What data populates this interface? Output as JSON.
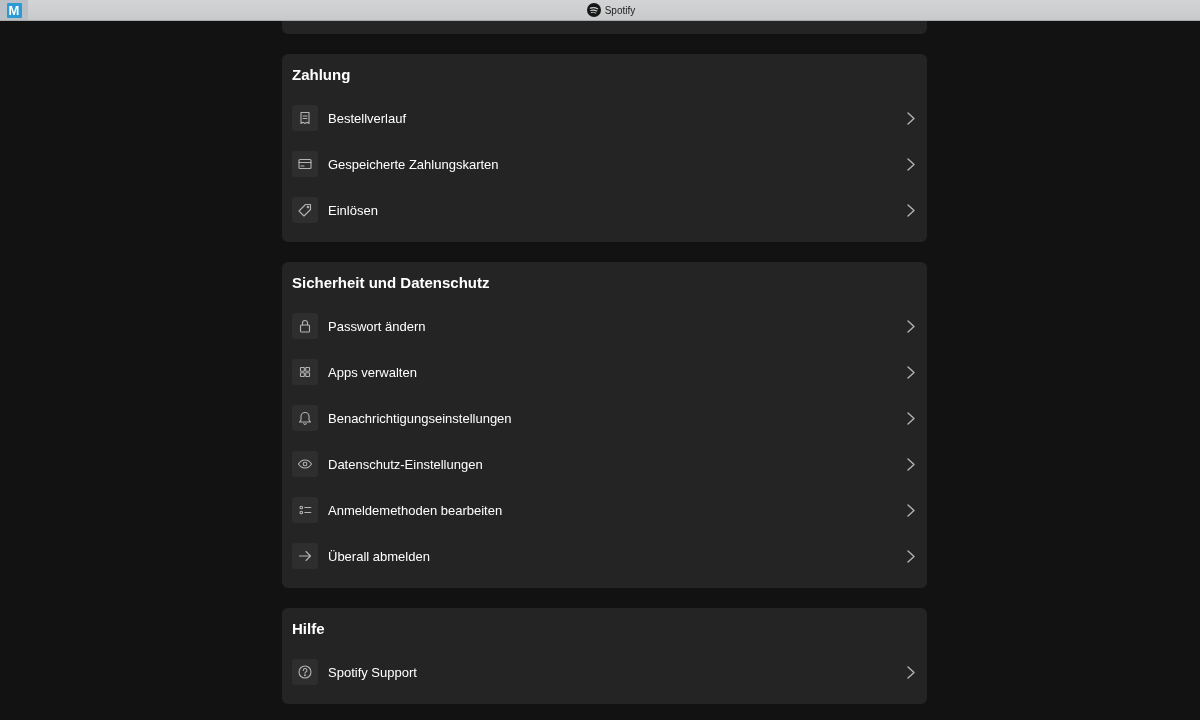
{
  "title_bar": {
    "app_icon_letter": "M",
    "title": "Spotify"
  },
  "sections": [
    {
      "title": "Zahlung",
      "items": [
        "Bestellverlauf",
        "Gespeicherte Zahlungskarten",
        "Einlösen"
      ]
    },
    {
      "title": "Sicherheit und Datenschutz",
      "items": [
        "Passwort ändern",
        "Apps verwalten",
        "Benachrichtigungseinstellungen",
        "Datenschutz-Einstellungen",
        "Anmeldemethoden bearbeiten",
        "Überall abmelden"
      ]
    },
    {
      "title": "Hilfe",
      "items": [
        "Spotify Support"
      ]
    }
  ]
}
